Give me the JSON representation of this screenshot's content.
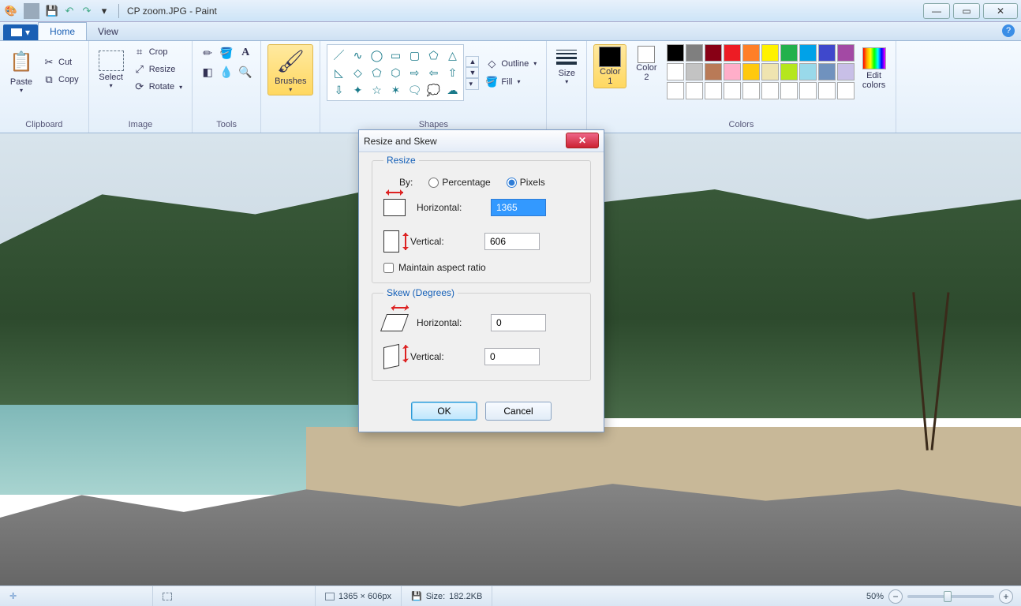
{
  "titlebar": {
    "filename": "CP zoom.JPG",
    "app": "Paint"
  },
  "tabs": {
    "file_symbol": "▾",
    "home": "Home",
    "view": "View"
  },
  "ribbon": {
    "clipboard": {
      "paste": "Paste",
      "cut": "Cut",
      "copy": "Copy",
      "label": "Clipboard"
    },
    "image": {
      "select": "Select",
      "crop": "Crop",
      "resize": "Resize",
      "rotate": "Rotate",
      "label": "Image"
    },
    "tools": {
      "label": "Tools"
    },
    "brushes": {
      "label": "Brushes"
    },
    "shapes": {
      "outline": "Outline",
      "fill": "Fill",
      "label": "Shapes"
    },
    "size": {
      "label": "Size"
    },
    "colors": {
      "color1": "Color\n1",
      "color2": "Color\n2",
      "edit": "Edit\ncolors",
      "label": "Colors",
      "c1_value": "#000000",
      "c2_value": "#ffffff",
      "palette_row1": [
        "#000000",
        "#7f7f7f",
        "#880015",
        "#ed1c24",
        "#ff7f27",
        "#fff200",
        "#22b14c",
        "#00a2e8",
        "#3f48cc",
        "#a349a4"
      ],
      "palette_row2": [
        "#ffffff",
        "#c3c3c3",
        "#b97a57",
        "#ffaec9",
        "#ffc90e",
        "#efe4b0",
        "#b5e61d",
        "#99d9ea",
        "#7092be",
        "#c8bfe7"
      ],
      "palette_row3": [
        "#ffffff",
        "#ffffff",
        "#ffffff",
        "#ffffff",
        "#ffffff",
        "#ffffff",
        "#ffffff",
        "#ffffff",
        "#ffffff",
        "#ffffff"
      ]
    }
  },
  "dialog": {
    "title": "Resize and Skew",
    "resize_legend": "Resize",
    "by_label": "By:",
    "percentage": "Percentage",
    "pixels": "Pixels",
    "horizontal": "Horizontal:",
    "vertical": "Vertical:",
    "h_value": "1365",
    "v_value": "606",
    "maintain": "Maintain aspect ratio",
    "skew_legend": "Skew (Degrees)",
    "skew_h": "0",
    "skew_v": "0",
    "ok": "OK",
    "cancel": "Cancel"
  },
  "statusbar": {
    "dimensions": "1365 × 606px",
    "size_label": "Size:",
    "size_value": "182.2KB",
    "zoom": "50%"
  }
}
